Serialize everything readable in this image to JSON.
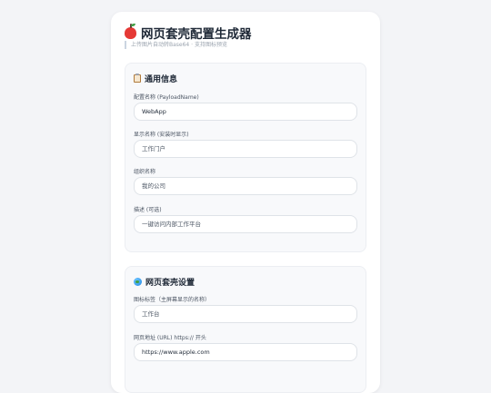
{
  "app": {
    "title": "网页套壳配置生成器",
    "subtitle": "上传图片自动转Base64 · 支持图标预览"
  },
  "sections": [
    {
      "title": "通用信息",
      "icon": "clipboard-icon",
      "fields": [
        {
          "label": "配置名称 (PayloadName)",
          "value": "WebApp",
          "placeholder": ""
        },
        {
          "label": "显示名称 (安装时显示)",
          "value": "",
          "placeholder": "工作门户"
        },
        {
          "label": "组织名称",
          "value": "",
          "placeholder": "我的公司"
        },
        {
          "label": "描述 (可选)",
          "value": "",
          "placeholder": "一键访问内部工作平台"
        }
      ]
    },
    {
      "title": "网页套壳设置",
      "icon": "globe-icon",
      "fields": [
        {
          "label": "图标标签（主屏幕显示的名称）",
          "value": "",
          "placeholder": "工作台"
        },
        {
          "label": "网页地址 (URL) https:// 开头",
          "value": "https://www.apple.com",
          "placeholder": ""
        }
      ]
    }
  ]
}
